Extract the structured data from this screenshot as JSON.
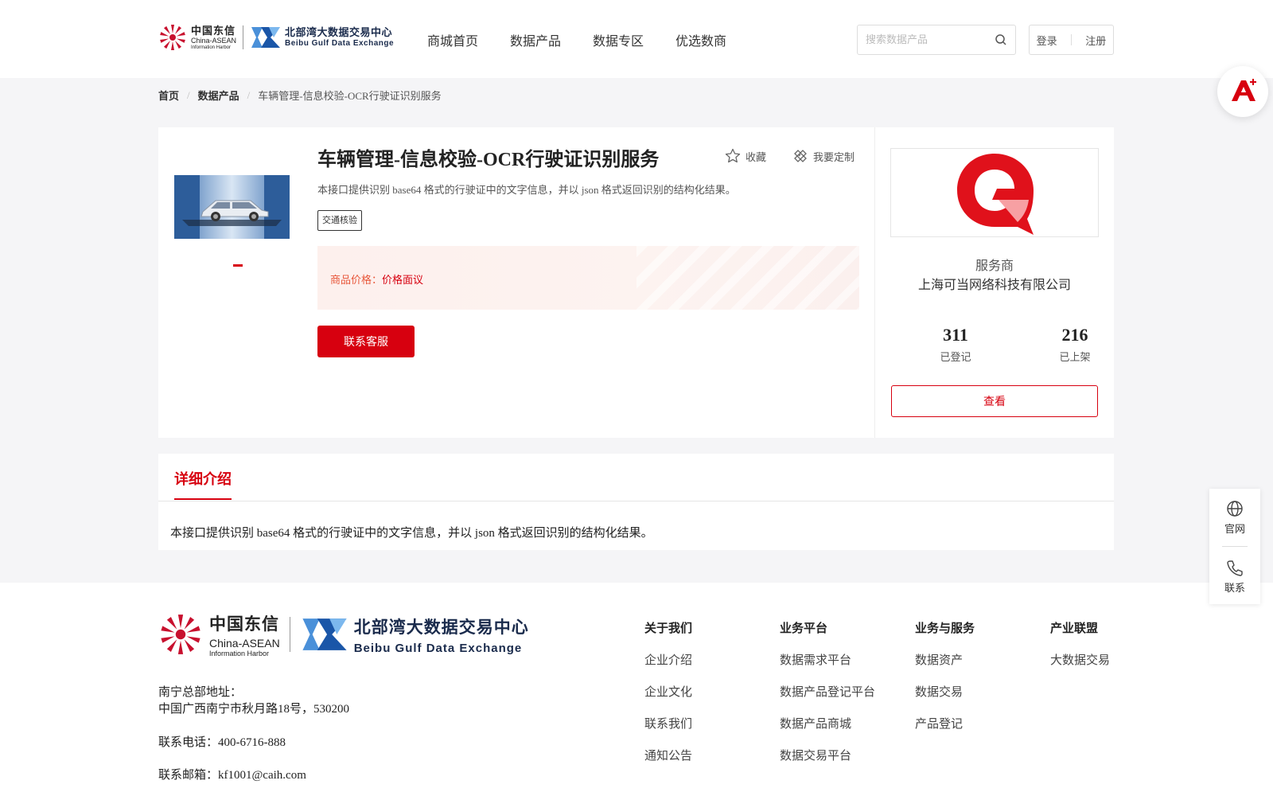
{
  "header": {
    "brand_cn": "中国东信",
    "brand_en1": "China-ASEAN",
    "brand_en2": "Information Harbor",
    "brand2_cn": "北部湾大数据交易中心",
    "brand2_en": "Beibu Gulf Data Exchange",
    "nav": [
      "商城首页",
      "数据产品",
      "数据专区",
      "优选数商"
    ],
    "search_placeholder": "搜索数据产品",
    "login": "登录",
    "register": "注册"
  },
  "breadcrumb": {
    "home": "首页",
    "products": "数据产品",
    "current": "车辆管理-信息校验-OCR行驶证识别服务"
  },
  "product": {
    "title": "车辆管理-信息校验-OCR行驶证识别服务",
    "favorite": "收藏",
    "customize": "我要定制",
    "description": "本接口提供识别 base64 格式的行驶证中的文字信息，并以 json 格式返回识别的结构化结果。",
    "tag": "交通核验",
    "price_label": "商品价格：",
    "price_value": "价格面议",
    "contact_button": "联系客服"
  },
  "provider": {
    "label": "服务商",
    "name": "上海可当网络科技有限公司",
    "registered_count": "311",
    "registered_label": "已登记",
    "listed_count": "216",
    "listed_label": "已上架",
    "view_button": "查看"
  },
  "detail": {
    "tab": "详细介绍",
    "text": "本接口提供识别 base64 格式的行驶证中的文字信息，并以 json 格式返回识别的结构化结果。"
  },
  "side_float": {
    "website": "官网",
    "contact": "联系"
  },
  "footer": {
    "brand_cn": "中国东信",
    "brand_en1": "China-ASEAN",
    "brand_en2": "Information Harbor",
    "brand2_cn": "北部湾大数据交易中心",
    "brand2_en": "Beibu Gulf Data Exchange",
    "address_label": "南宁总部地址：",
    "address": "中国广西南宁市秋月路18号，530200",
    "phone": "联系电话：400-6716-888",
    "email": "联系邮箱：kf1001@caih.com",
    "columns": [
      {
        "title": "关于我们",
        "items": [
          "企业介绍",
          "企业文化",
          "联系我们",
          "通知公告"
        ]
      },
      {
        "title": "业务平台",
        "items": [
          "数据需求平台",
          "数据产品登记平台",
          "数据产品商城",
          "数据交易平台"
        ]
      },
      {
        "title": "业务与服务",
        "items": [
          "数据资产",
          "数据交易",
          "产品登记"
        ]
      },
      {
        "title": "产业联盟",
        "items": [
          "大数据交易"
        ]
      }
    ]
  },
  "colors": {
    "accent": "#d7000f",
    "price": "#e8573b",
    "page_bg": "#f5f5f7"
  }
}
